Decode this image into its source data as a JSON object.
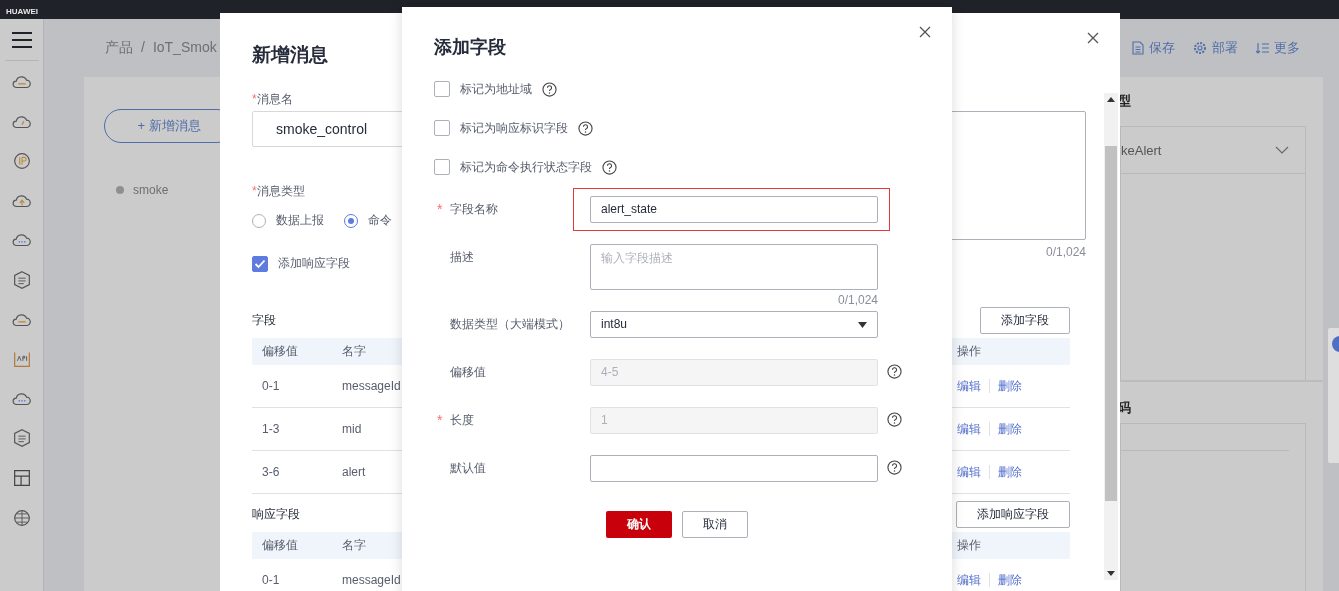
{
  "top_bar": {
    "logo": "HUAWEI"
  },
  "breadcrumb": {
    "items": [
      "产品",
      "IoT_Smok"
    ],
    "separator": "/"
  },
  "toolbar": [
    {
      "kind": "save",
      "label": "保存"
    },
    {
      "kind": "deploy",
      "label": "部署"
    },
    {
      "kind": "more",
      "label": "更多"
    }
  ],
  "message_panel": {
    "add_button": "+ 新增消息",
    "messages": [
      {
        "name": "smoke"
      }
    ]
  },
  "right_panel": {
    "heading_1": "型",
    "select_value": "keAlert",
    "heading_2": "码"
  },
  "message_dialog": {
    "title": "新增消息",
    "name_mark": "*",
    "name_label": "消息名",
    "name_value": "smoke_control",
    "type_mark": "*",
    "type_label": "消息类型",
    "type_options": [
      {
        "label": "数据上报",
        "selected": false
      },
      {
        "label": "命令",
        "selected": true
      }
    ],
    "add_response": {
      "label": "添加响应字段",
      "checked": true
    },
    "description_count": "0/1,024",
    "fields": {
      "title": "字段",
      "add_button": "添加字段",
      "columns": [
        "偏移值",
        "名字",
        "操作"
      ],
      "rows": [
        {
          "offset": "0-1",
          "name": "messageId",
          "actions": [
            "编辑",
            "删除"
          ]
        },
        {
          "offset": "1-3",
          "name": "mid",
          "actions": [
            "编辑",
            "删除"
          ]
        },
        {
          "offset": "3-6",
          "name": "alert",
          "actions": [
            "编辑",
            "删除"
          ]
        }
      ]
    },
    "response_fields": {
      "title": "响应字段",
      "add_button": "添加响应字段",
      "columns": [
        "偏移值",
        "名字",
        "操作"
      ],
      "rows": [
        {
          "offset": "0-1",
          "name": "messageId",
          "actions": [
            "编辑",
            "删除"
          ]
        }
      ]
    }
  },
  "field_dialog": {
    "title": "添加字段",
    "flags": [
      {
        "label": "标记为地址域",
        "checked": false
      },
      {
        "label": "标记为响应标识字段",
        "checked": false
      },
      {
        "label": "标记为命令执行状态字段",
        "checked": false
      }
    ],
    "form": [
      {
        "kind": "input",
        "required_mark": "*",
        "label": "字段名称",
        "value": "alert_state",
        "highlighted": true,
        "disabled": false,
        "help": false
      },
      {
        "kind": "textarea",
        "label": "描述",
        "placeholder": "输入字段描述",
        "count": "0/1,024",
        "highlighted": false,
        "help": false
      },
      {
        "kind": "select",
        "label": "数据类型（大端模式）",
        "value": "int8u",
        "highlighted": false,
        "help": false
      },
      {
        "kind": "input",
        "label": "偏移值",
        "value": "4-5",
        "highlighted": false,
        "disabled": true,
        "help": true
      },
      {
        "kind": "input",
        "required_mark": "*",
        "label": "长度",
        "value": "1",
        "highlighted": false,
        "disabled": true,
        "help": true
      },
      {
        "kind": "input",
        "label": "默认值",
        "highlighted": false,
        "disabled": false,
        "help": true
      }
    ],
    "buttons": [
      {
        "kind": "primary",
        "label": "确认"
      },
      {
        "kind": "secondary",
        "label": "取消"
      }
    ]
  }
}
